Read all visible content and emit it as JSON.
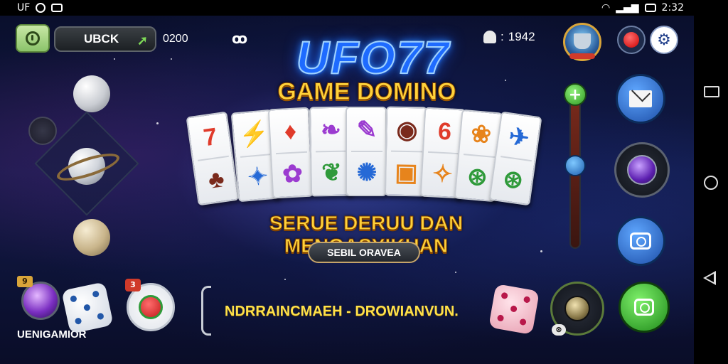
{
  "status_bar": {
    "app_label": "UF",
    "time": "2:32",
    "icons": [
      "location-icon",
      "media-icon",
      "wifi-icon",
      "signal-icon",
      "battery-icon"
    ]
  },
  "top_bar": {
    "username": "UBCK",
    "balance": "0200",
    "mark": "ꝏ",
    "online_count": "1942",
    "online_separator": ":"
  },
  "hero": {
    "logo": "UFO77",
    "subtitle": "GAME DOMINO",
    "tagline": "SERUE DERUU DAN MENGASYIKHAN",
    "play_button": "SEBIL ORAVEA"
  },
  "tiles": [
    {
      "top": "7",
      "bottom": "♣",
      "top_color": "red",
      "bottom_color": "brown"
    },
    {
      "top": "⚡",
      "bottom": "✦",
      "top_color": "purple",
      "bottom_color": "blue"
    },
    {
      "top": "♦",
      "bottom": "✿",
      "top_color": "red",
      "bottom_color": "purple"
    },
    {
      "top": "❧",
      "bottom": "❦",
      "top_color": "purple",
      "bottom_color": "green"
    },
    {
      "top": "✎",
      "bottom": "✺",
      "top_color": "purple",
      "bottom_color": "blue"
    },
    {
      "top": "◉",
      "bottom": "▣",
      "top_color": "brown",
      "bottom_color": "orange"
    },
    {
      "top": "6",
      "bottom": "✧",
      "top_color": "red",
      "bottom_color": "orange"
    },
    {
      "top": "❀",
      "bottom": "⊛",
      "top_color": "orange",
      "bottom_color": "green"
    },
    {
      "top": "✈",
      "bottom": "⊛",
      "top_color": "blue",
      "bottom_color": "green"
    }
  ],
  "bottom": {
    "crystal_badge": "9",
    "crystal_label": "UENIGAMIOR",
    "heart_badge": "3",
    "ticker": "NDRRAINCMAEH - DROWIANVUN.",
    "joy_tag": "⊗"
  },
  "colors": {
    "accent_gold": "#ffd23a",
    "logo_blue": "#1e6bff",
    "ticker_yellow": "#ffe14a"
  }
}
